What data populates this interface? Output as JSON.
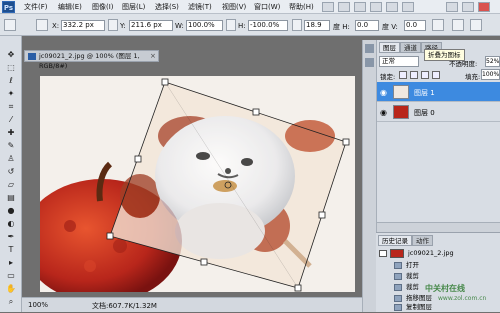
{
  "app": {
    "logo": "Ps"
  },
  "menu": {
    "items": [
      "文件(F)",
      "编辑(E)",
      "图像(I)",
      "图层(L)",
      "选择(S)",
      "滤镜(T)",
      "视图(V)",
      "窗口(W)",
      "帮助(H)"
    ]
  },
  "options": {
    "x_label": "X:",
    "x_value": "332.2 px",
    "y_label": "Y:",
    "y_value": "211.6 px",
    "w_label": "W:",
    "w_value": "100.0%",
    "h_label": "H:",
    "h_value": "-100.0%",
    "angle_value": "18.9",
    "hskew_label": "度 H:",
    "hskew_value": "0.0",
    "vskew_label": "度 V:",
    "vskew_value": "0.0"
  },
  "document": {
    "tab_title": "jc09021_2.jpg @ 100% (图层 1, RGB/8#)",
    "close": "×"
  },
  "status": {
    "zoom": "100%",
    "doc_info": "文档:607.7K/1.32M"
  },
  "panels": {
    "layers_tabs": [
      "图层",
      "通道",
      "路径"
    ],
    "tooltip": "折叠为图标",
    "blend_mode": "正常",
    "opacity_label": "不透明度:",
    "opacity_value": "52%",
    "lock_label": "锁定:",
    "fill_label": "填充:",
    "fill_value": "100%",
    "layers": [
      {
        "name": "图层 1",
        "selected": true
      },
      {
        "name": "图层 0",
        "selected": false
      }
    ]
  },
  "history": {
    "tabs": [
      "历史记录",
      "动作"
    ],
    "snapshot": "jc09021_2.jpg",
    "items": [
      "打开",
      "裁剪",
      "裁剪",
      "拖移图层",
      "复制图层"
    ]
  },
  "watermark": {
    "text": "中关村在线",
    "sub": "www.zol.com.cn"
  },
  "colors": {
    "selected_layer": "#3d8ae0",
    "menubar": "#e9edf2"
  }
}
